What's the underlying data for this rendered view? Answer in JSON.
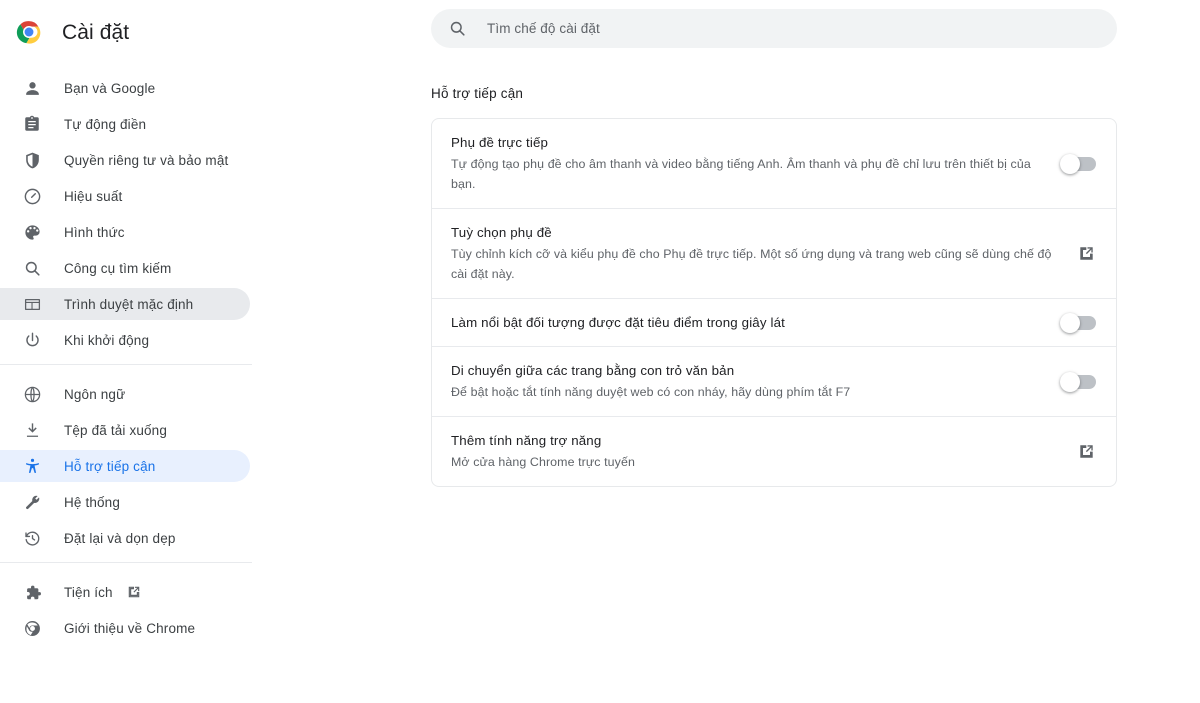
{
  "app": {
    "title": "Cài đặt",
    "logo_icon": "chrome-logo"
  },
  "search": {
    "placeholder": "Tìm chế độ cài đặt",
    "value": "",
    "icon": "search-icon"
  },
  "sidebar": {
    "groups": [
      {
        "items": [
          {
            "label": "Bạn và Google",
            "icon": "person-icon",
            "state": "normal"
          },
          {
            "label": "Tự động điền",
            "icon": "clipboard-icon",
            "state": "normal"
          },
          {
            "label": "Quyền riêng tư và bảo mật",
            "icon": "shield-icon",
            "state": "normal"
          },
          {
            "label": "Hiệu suất",
            "icon": "speedometer-icon",
            "state": "normal"
          },
          {
            "label": "Hình thức",
            "icon": "palette-icon",
            "state": "normal"
          },
          {
            "label": "Công cụ tìm kiếm",
            "icon": "search-icon",
            "state": "normal"
          },
          {
            "label": "Trình duyệt mặc định",
            "icon": "browser-window-icon",
            "state": "hovered"
          },
          {
            "label": "Khi khởi động",
            "icon": "power-icon",
            "state": "normal"
          }
        ]
      },
      {
        "items": [
          {
            "label": "Ngôn ngữ",
            "icon": "globe-icon",
            "state": "normal"
          },
          {
            "label": "Tệp đã tải xuống",
            "icon": "download-icon",
            "state": "normal"
          },
          {
            "label": "Hỗ trợ tiếp cận",
            "icon": "accessibility-icon",
            "state": "active"
          },
          {
            "label": "Hệ thống",
            "icon": "wrench-icon",
            "state": "normal"
          },
          {
            "label": "Đặt lại và dọn dẹp",
            "icon": "restore-icon",
            "state": "normal"
          }
        ]
      },
      {
        "items": [
          {
            "label": "Tiện ích",
            "icon": "puzzle-icon",
            "state": "normal",
            "external": true
          },
          {
            "label": "Giới thiệu về Chrome",
            "icon": "chrome-outline-icon",
            "state": "normal"
          }
        ]
      }
    ]
  },
  "main": {
    "section_title": "Hỗ trợ tiếp cận",
    "rows": [
      {
        "title": "Phụ đề trực tiếp",
        "subtitle": "Tự động tạo phụ đề cho âm thanh và video bằng tiếng Anh. Âm thanh và phụ đề chỉ lưu trên thiết bị của bạn.",
        "action": "toggle",
        "toggle_on": false
      },
      {
        "title": "Tuỳ chọn phụ đề",
        "subtitle": "Tùy chỉnh kích cỡ và kiểu phụ đề cho Phụ đề trực tiếp. Một số ứng dụng và trang web cũng sẽ dùng chế độ cài đặt này.",
        "action": "external-link"
      },
      {
        "title": "Làm nổi bật đối tượng được đặt tiêu điểm trong giây lát",
        "subtitle": "",
        "action": "toggle",
        "toggle_on": false
      },
      {
        "title": "Di chuyển giữa các trang bằng con trỏ văn bản",
        "subtitle": "Để bật hoặc tắt tính năng duyệt web có con nháy, hãy dùng phím tắt F7",
        "action": "toggle",
        "toggle_on": false
      },
      {
        "title": "Thêm tính năng trợ năng",
        "subtitle": "Mở cửa hàng Chrome trực tuyến",
        "action": "external-link"
      }
    ]
  },
  "colors": {
    "accent": "#1a73e8",
    "active_pill": "#e8f0fe",
    "hover_pill": "#e8eaed",
    "text_primary": "#202124",
    "text_secondary": "#5f6368",
    "toggle_off_track": "#bdc1c6",
    "card_border": "#e7e9eb",
    "search_bg": "#f1f3f4"
  }
}
